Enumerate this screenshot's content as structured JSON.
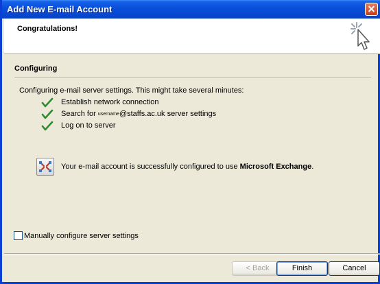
{
  "window": {
    "title": "Add New E-mail Account"
  },
  "header": {
    "heading": "Congratulations!"
  },
  "section": {
    "title": "Configuring"
  },
  "intro": "Configuring e-mail server settings. This might take several minutes:",
  "steps": [
    {
      "label": "Establish network connection",
      "status": "done"
    },
    {
      "label_prefix": "Search for ",
      "redacted": "username",
      "label_suffix": "@staffs.ac.uk server settings",
      "status": "done"
    },
    {
      "label": "Log on to server",
      "status": "done"
    }
  ],
  "status": {
    "text_prefix": "Your e-mail account is successfully configured to use ",
    "text_bold": "Microsoft Exchange",
    "text_suffix": "."
  },
  "checkbox": {
    "label": "Manually configure server settings",
    "checked": false
  },
  "buttons": {
    "back": "< Back",
    "finish": "Finish",
    "cancel": "Cancel"
  },
  "colors": {
    "titlebar": "#0a50dc",
    "check": "#2e8b2e",
    "dialog_bg": "#ece9d8"
  },
  "icons": [
    "close-icon",
    "cursor-sparkle-icon",
    "checkmark-icon",
    "exchange-icon"
  ]
}
